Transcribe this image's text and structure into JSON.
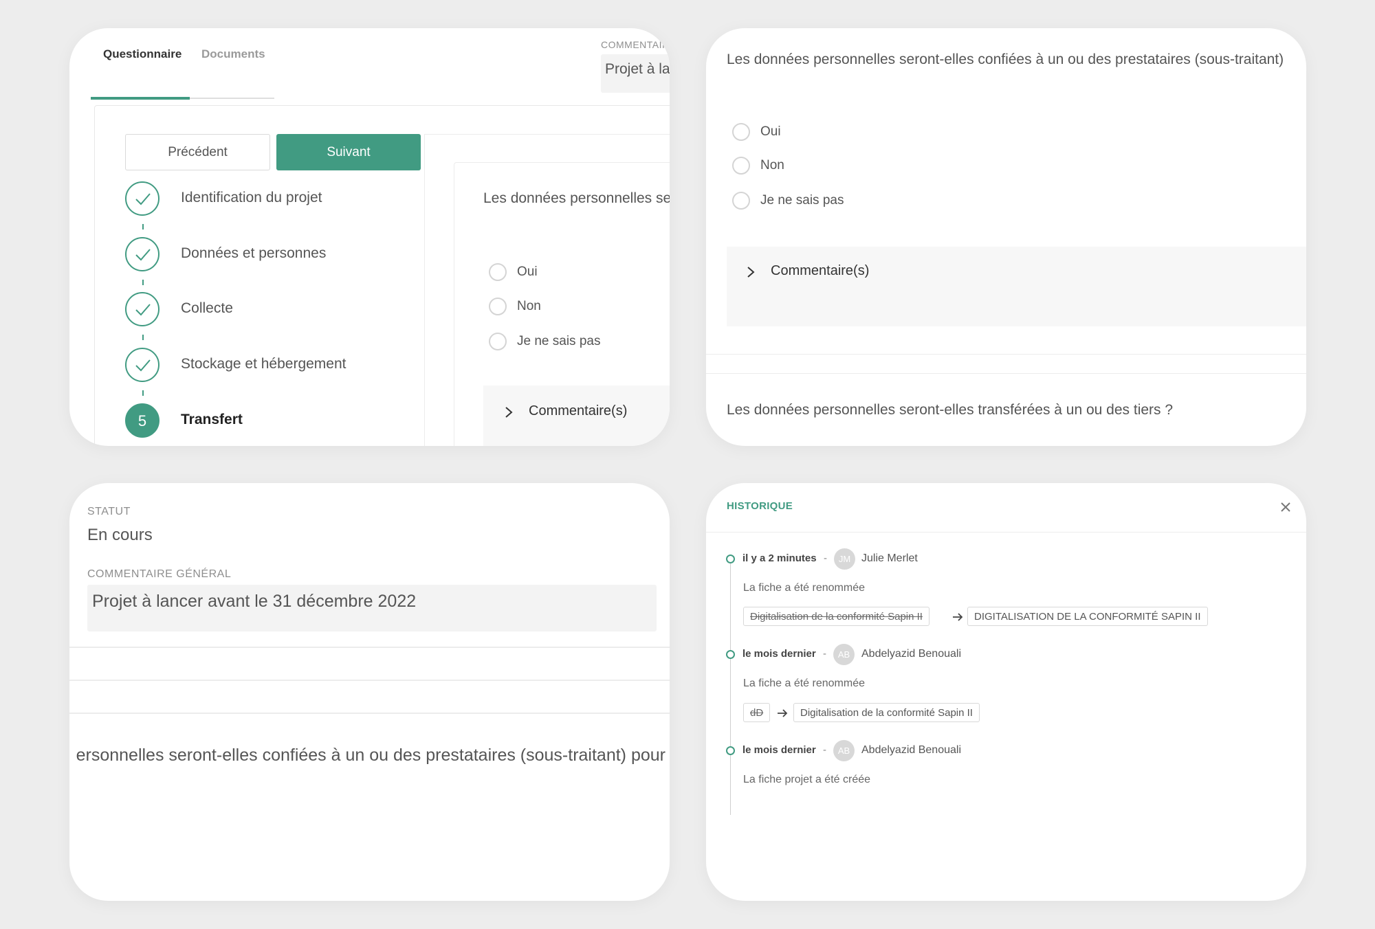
{
  "colors": {
    "accent": "#419b82",
    "background": "#ededed"
  },
  "card1": {
    "tabs": [
      {
        "label": "Questionnaire",
        "active": true
      },
      {
        "label": "Documents",
        "active": false
      }
    ],
    "comment_label": "COMMENTAIRE",
    "comment_value": "Projet à la",
    "prev_label": "Précédent",
    "next_label": "Suivant",
    "steps": [
      {
        "label": "Identification du projet",
        "state": "done",
        "icon": "check-icon"
      },
      {
        "label": "Données et personnes",
        "state": "done",
        "icon": "check-icon"
      },
      {
        "label": "Collecte",
        "state": "done",
        "icon": "check-icon"
      },
      {
        "label": "Stockage et hébergement",
        "state": "done",
        "icon": "check-icon"
      },
      {
        "label": "Transfert",
        "state": "current",
        "number": "5"
      }
    ],
    "question": "Les données personnelles se",
    "options": [
      "Oui",
      "Non",
      "Je ne sais pas"
    ],
    "comments_label": "Commentaire(s)"
  },
  "card2": {
    "question1": "Les données personnelles seront-elles confiées à un ou des prestataires (sous-traitant)",
    "options": [
      "Oui",
      "Non",
      "Je ne sais pas"
    ],
    "comments_label": "Commentaire(s)",
    "question2": "Les données personnelles seront-elles transférées à un ou des tiers ?"
  },
  "card3": {
    "status_label": "STATUT",
    "status_value": "En cours",
    "general_comment_label": "COMMENTAIRE GÉNÉRAL",
    "general_comment_value": "Projet à lancer avant le 31 décembre 2022",
    "question_clipped": "ersonnelles seront-elles confiées à un ou des prestataires (sous-traitant) pour"
  },
  "card4": {
    "title": "HISTORIQUE",
    "entries": [
      {
        "time": "il y a 2 minutes",
        "avatar": "JM",
        "user": "Julie Merlet",
        "description": "La fiche a été renommée",
        "old_value": "Digitalisation de la conformité Sapin II",
        "new_value": "DIGITALISATION DE LA CONFORMITÉ SAPIN II"
      },
      {
        "time": "le mois dernier",
        "avatar": "AB",
        "user": "Abdelyazid Benouali",
        "description": "La fiche a été renommée",
        "old_value": "dD",
        "new_value": "Digitalisation de la conformité Sapin II"
      },
      {
        "time": "le mois dernier",
        "avatar": "AB",
        "user": "Abdelyazid Benouali",
        "description": "La fiche projet a été créée"
      }
    ]
  }
}
